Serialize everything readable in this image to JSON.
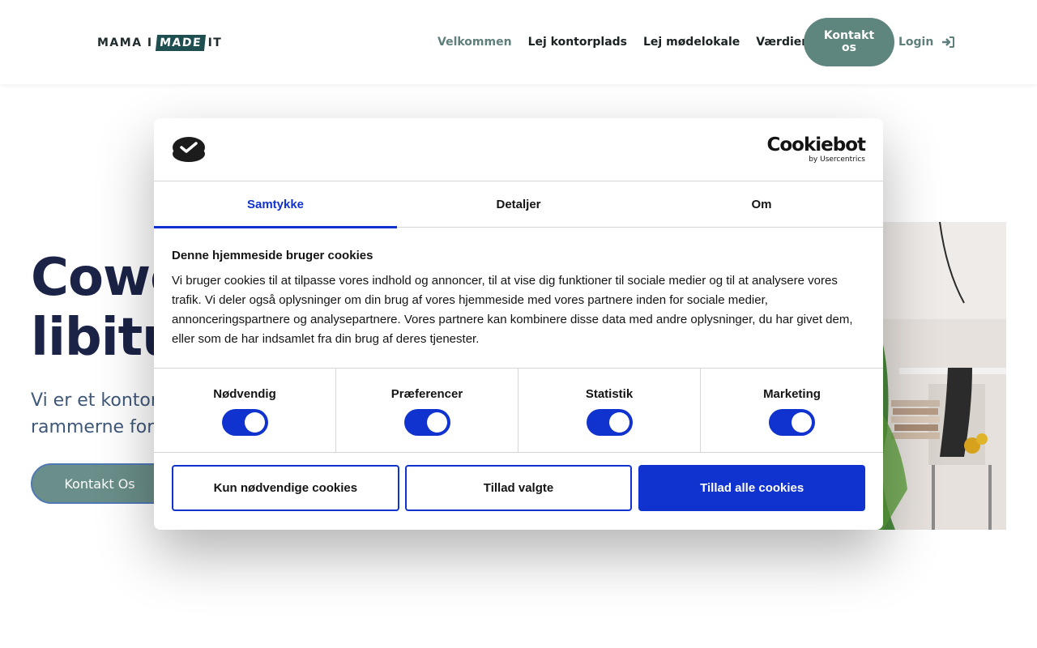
{
  "header": {
    "logo_parts": [
      "MAMA I",
      "MADE",
      "IT"
    ],
    "nav": [
      {
        "label": "Velkommen"
      },
      {
        "label": "Lej kontorplads"
      },
      {
        "label": "Lej mødelokale"
      },
      {
        "label": "Værdierne bag"
      }
    ],
    "contact_button": "Kontakt os",
    "login": "Login"
  },
  "hero": {
    "title_line1": "Cowo",
    "title_line2": "libitu",
    "subtitle_line1": "Vi er et kontor",
    "subtitle_line2": "rammerne for",
    "button": "Kontakt Os"
  },
  "cookie_dialog": {
    "brand": "Cookiebot",
    "brand_sub": "by Usercentrics",
    "tabs": [
      {
        "label": "Samtykke",
        "active": true
      },
      {
        "label": "Detaljer",
        "active": false
      },
      {
        "label": "Om",
        "active": false
      }
    ],
    "heading": "Denne hjemmeside bruger cookies",
    "body": "Vi bruger cookies til at tilpasse vores indhold og annoncer, til at vise dig funktioner til sociale medier og til at analysere vores trafik. Vi deler også oplysninger om din brug af vores hjemmeside med vores partnere inden for sociale medier, annonceringspartnere og analysepartnere. Vores partnere kan kombinere disse data med andre oplysninger, du har givet dem, eller som de har indsamlet fra din brug af deres tjenester.",
    "categories": [
      {
        "label": "Nødvendig",
        "enabled": true
      },
      {
        "label": "Præferencer",
        "enabled": true
      },
      {
        "label": "Statistik",
        "enabled": true
      },
      {
        "label": "Marketing",
        "enabled": true
      }
    ],
    "buttons": {
      "necessary_only": "Kun nødvendige cookies",
      "allow_selected": "Tillad valgte",
      "allow_all": "Tillad alle cookies"
    }
  },
  "colors": {
    "accent": "#1032cf",
    "brand_green": "#5f857f",
    "hero_title": "#1b2346"
  },
  "icons": [
    "cookiebot-check-icon",
    "login-arrow-icon"
  ]
}
